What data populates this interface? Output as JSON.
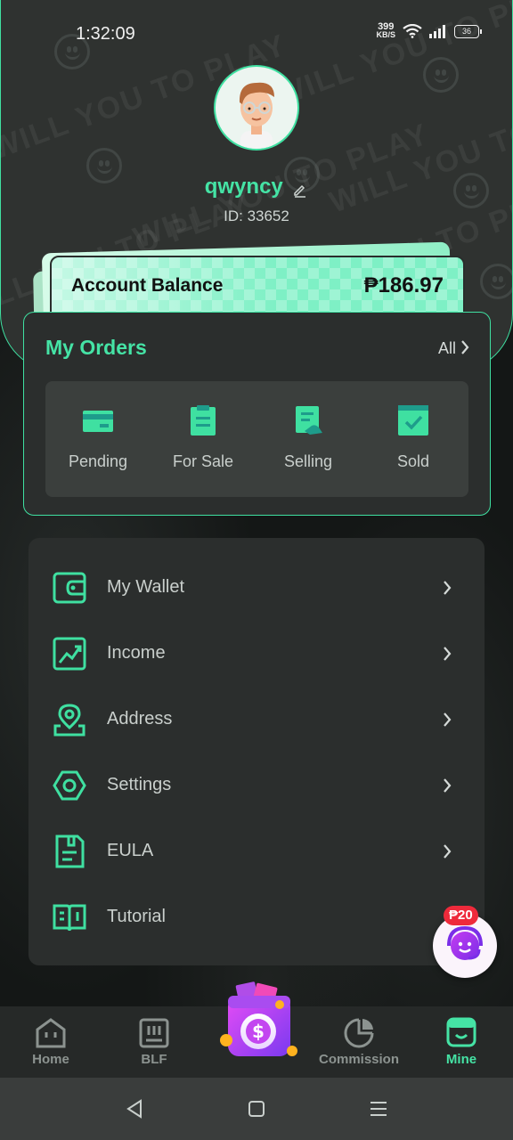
{
  "status_bar": {
    "time": "1:32:09",
    "net_speed_value": "399",
    "net_speed_unit": "KB/S",
    "battery": "36"
  },
  "header": {
    "watermark": "WILL YOU TO PLAY"
  },
  "profile": {
    "username": "qwyncy",
    "user_id": "ID: 33652"
  },
  "balance": {
    "label": "Account Balance",
    "amount": "₱186.97"
  },
  "orders": {
    "title": "My Orders",
    "all_label": "All",
    "items": [
      {
        "label": "Pending",
        "icon": "card-icon"
      },
      {
        "label": "For Sale",
        "icon": "clipboard-icon"
      },
      {
        "label": "Selling",
        "icon": "document-hand-icon"
      },
      {
        "label": "Sold",
        "icon": "check-box-icon"
      }
    ]
  },
  "menu": {
    "items": [
      {
        "label": "My Wallet",
        "icon": "wallet-icon"
      },
      {
        "label": "Income",
        "icon": "chart-trend-icon"
      },
      {
        "label": "Address",
        "icon": "location-pin-icon"
      },
      {
        "label": "Settings",
        "icon": "hexagon-settings-icon"
      },
      {
        "label": "EULA",
        "icon": "document-icon"
      },
      {
        "label": "Tutorial",
        "icon": "open-book-icon"
      }
    ]
  },
  "floating_support": {
    "badge": "₱20"
  },
  "bottom_nav": {
    "items": [
      {
        "label": "Home",
        "icon": "home-icon"
      },
      {
        "label": "BLF",
        "icon": "blf-icon"
      },
      {
        "label": "",
        "icon": "dollar-coin-bag-icon"
      },
      {
        "label": "Commission",
        "icon": "pie-chart-icon"
      },
      {
        "label": "Mine",
        "icon": "mine-icon"
      }
    ],
    "active": "Mine"
  },
  "colors": {
    "accent": "#45e3a5",
    "panel": "#2b2e2d",
    "badge_red": "#ee2a3b"
  }
}
